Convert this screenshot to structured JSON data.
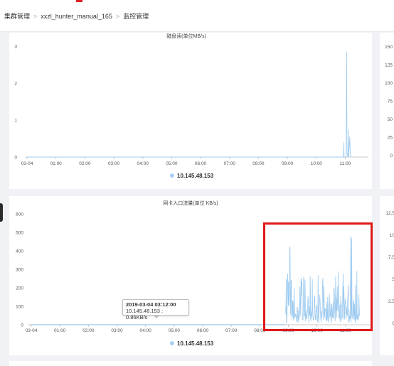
{
  "breadcrumb": {
    "items": [
      "集群管理",
      "xxzl_hunter_manual_165",
      "监控管理"
    ],
    "separator": ">"
  },
  "colors": {
    "series": "#9ecbf0",
    "legend_dot": "#a9d0f5",
    "axis": "#c8c8c8",
    "highlight": "#e01818"
  },
  "tooltip": {
    "title": "2019-03-04 03:12:00",
    "line": "10.145.48.153 : 0.86KB/s"
  },
  "right_panel_1_ticks": [
    "150",
    "125",
    "100",
    "75",
    "50",
    "25",
    "0"
  ],
  "right_panel_2_ticks": [
    "12.5",
    "10",
    "7.5",
    "5",
    "2.5",
    "0"
  ],
  "chart_data": [
    {
      "type": "line",
      "title": "磁盘读(单位MB/s)",
      "xlabel": "",
      "ylabel": "",
      "x_ticks": [
        "03-04",
        "01:00",
        "02:00",
        "03:00",
        "04:00",
        "05:00",
        "06:00",
        "07:00",
        "08:00",
        "09:00",
        "10:00",
        "11:00"
      ],
      "y_ticks": [
        "0",
        "1",
        "2",
        "3"
      ],
      "ylim": [
        0,
        3
      ],
      "grid": false,
      "legend": "bottom",
      "series": [
        {
          "name": "10.145.48.153",
          "points": [
            [
              10.94,
              0
            ],
            [
              10.95,
              0.4
            ],
            [
              10.96,
              0
            ],
            [
              11.03,
              0
            ],
            [
              11.05,
              2.85
            ],
            [
              11.06,
              0.1
            ],
            [
              11.09,
              0
            ],
            [
              11.11,
              0.75
            ],
            [
              11.12,
              0
            ],
            [
              11.16,
              0.55
            ],
            [
              11.18,
              0
            ],
            [
              11.25,
              0
            ]
          ]
        }
      ]
    },
    {
      "type": "line",
      "title": "网卡入口流量(单位 KB/s)",
      "xlabel": "",
      "ylabel": "",
      "x_ticks": [
        "03-04",
        "01:00",
        "02:00",
        "03:00",
        "04:00",
        "05:00",
        "06:00",
        "07:00",
        "08:00",
        "09:00",
        "10:00",
        "11:00"
      ],
      "y_ticks": [
        "0",
        "100",
        "200",
        "300",
        "400",
        "500",
        "600"
      ],
      "ylim": [
        0,
        600
      ],
      "grid": false,
      "legend": "bottom",
      "series": [
        {
          "name": "10.145.48.153",
          "baseline": 1,
          "start": 8.9,
          "end": 11.5,
          "peaks": [
            [
              9.05,
              420
            ],
            [
              9.1,
              240
            ],
            [
              9.55,
              250
            ],
            [
              10.2,
              230
            ],
            [
              10.6,
              200
            ],
            [
              10.75,
              290
            ],
            [
              11.18,
              480
            ],
            [
              11.22,
              470
            ],
            [
              11.4,
              290
            ]
          ]
        }
      ]
    }
  ]
}
